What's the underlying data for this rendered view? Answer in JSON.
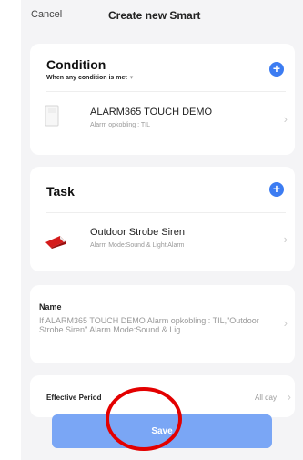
{
  "header": {
    "cancel_label": "Cancel",
    "title": "Create new Smart"
  },
  "condition": {
    "title": "Condition",
    "subtitle": "When any condition is met",
    "device_name": "ALARM365 TOUCH DEMO",
    "device_state": "Alarm opkobling : TIL"
  },
  "task": {
    "title": "Task",
    "device_name": "Outdoor Strobe Siren",
    "device_state": "Alarm Mode:Sound & Light Alarm"
  },
  "name": {
    "title": "Name",
    "value": "If ALARM365 TOUCH DEMO Alarm opkobling : TIL,\"Outdoor Strobe Siren\" Alarm Mode:Sound & Lig"
  },
  "period": {
    "title": "Effective Period",
    "value": "All day"
  },
  "save_label": "Save",
  "colors": {
    "accent": "#3c7cf2",
    "save_button": "#7aa6f5",
    "annotation": "#e30000"
  },
  "icons": [
    "chevron-down-icon",
    "plus-icon",
    "chevron-right-icon",
    "alarm-panel-icon",
    "siren-icon"
  ]
}
